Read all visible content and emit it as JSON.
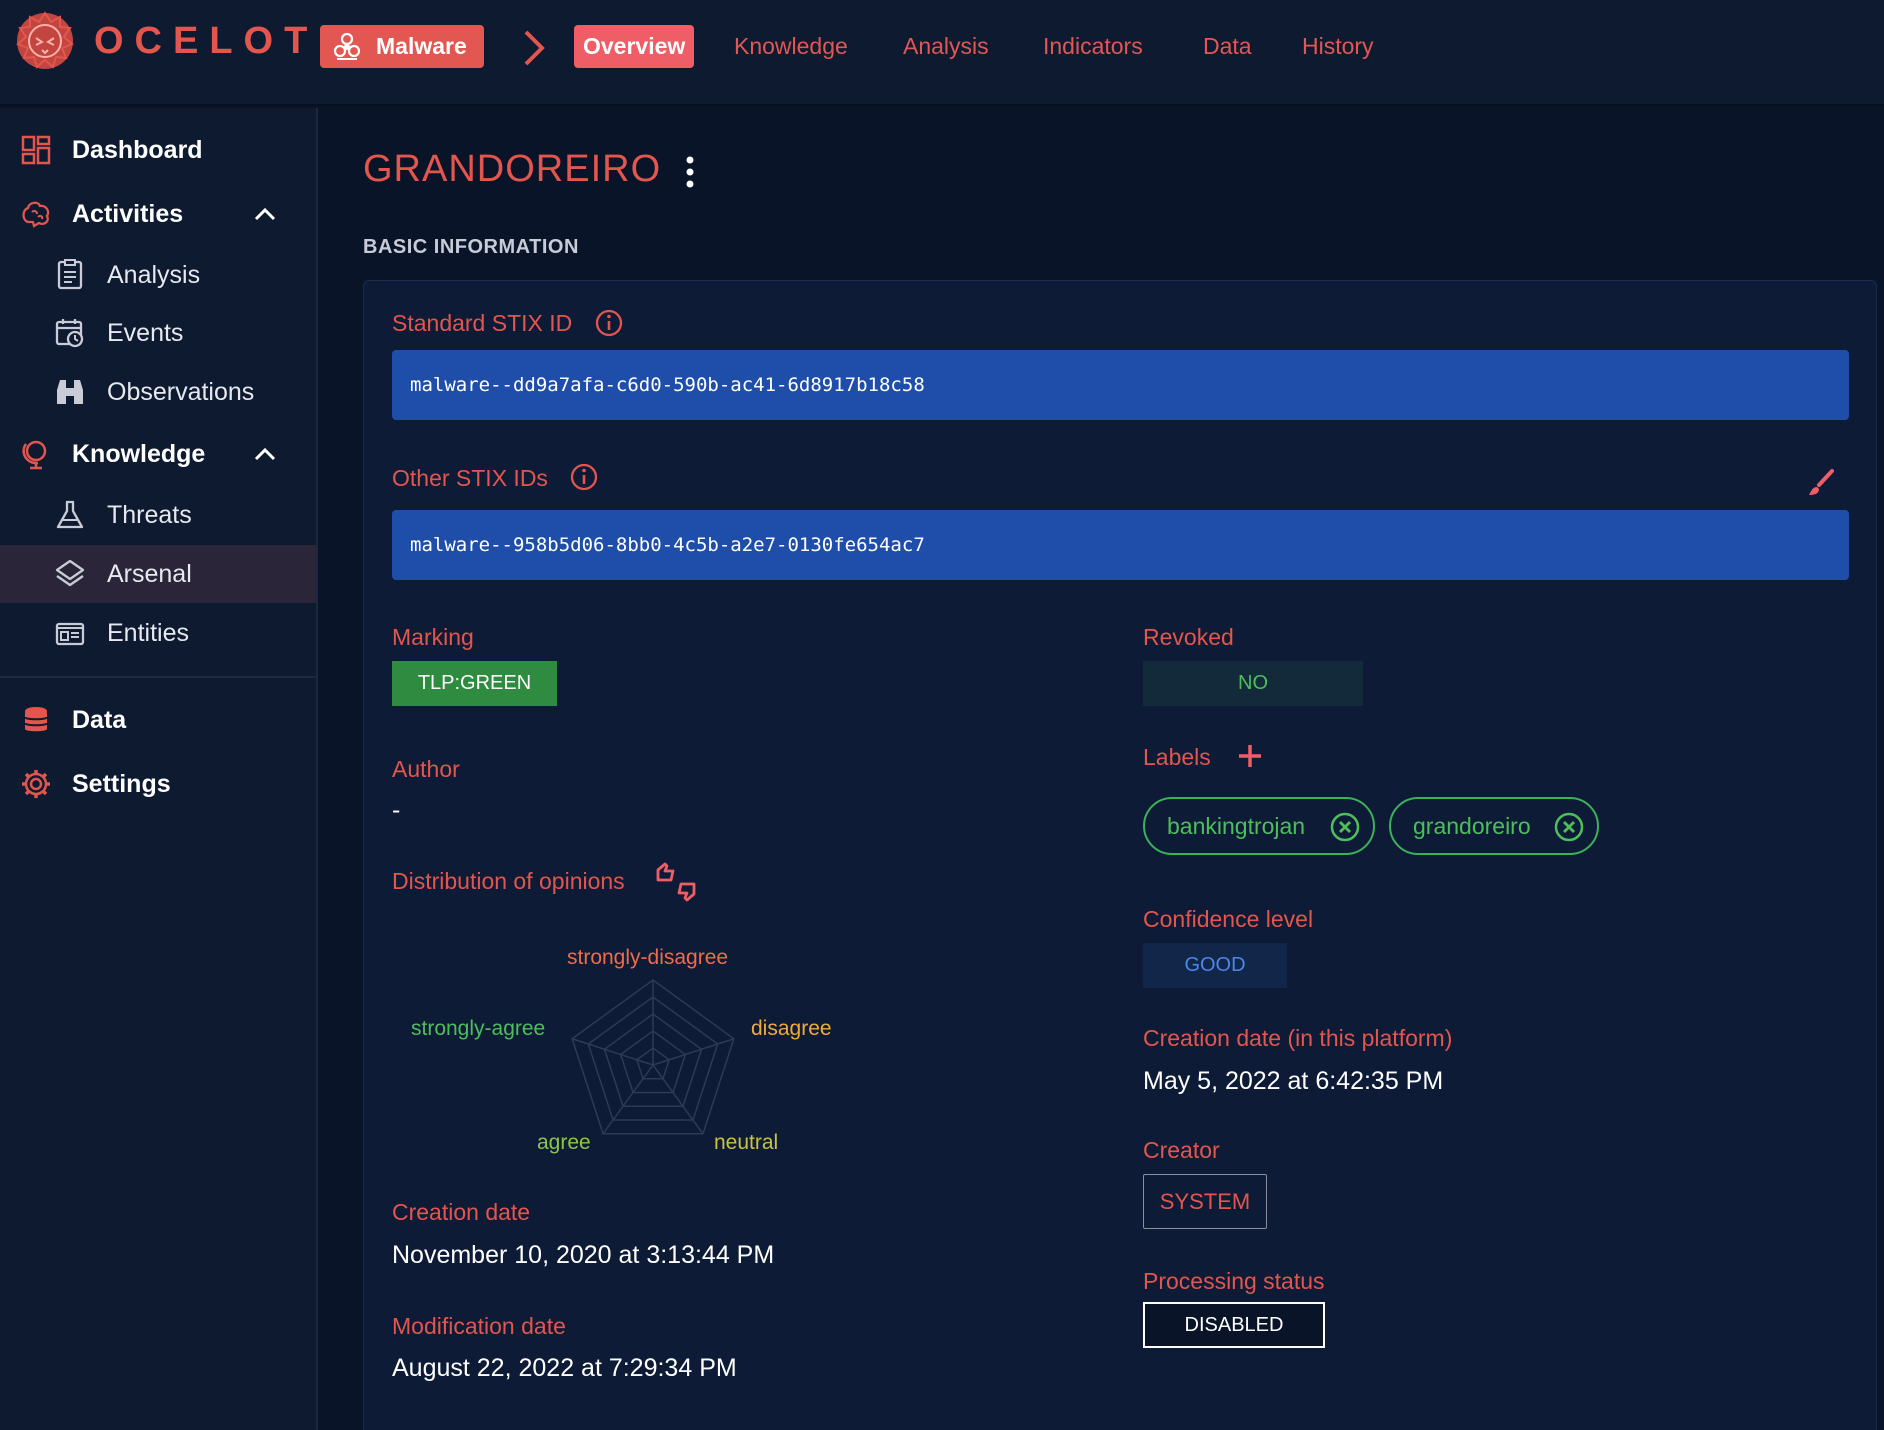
{
  "app": {
    "brand": "OCELOT"
  },
  "topbar": {
    "entity_type": "Malware",
    "tabs": [
      {
        "label": "Overview",
        "active": true
      },
      {
        "label": "Knowledge"
      },
      {
        "label": "Analysis"
      },
      {
        "label": "Indicators"
      },
      {
        "label": "Data"
      },
      {
        "label": "History"
      }
    ]
  },
  "sidebar": {
    "dashboard": "Dashboard",
    "activities": "Activities",
    "analysis": "Analysis",
    "events": "Events",
    "observations": "Observations",
    "knowledge": "Knowledge",
    "threats": "Threats",
    "arsenal": "Arsenal",
    "entities": "Entities",
    "data": "Data",
    "settings": "Settings",
    "selected": "Arsenal"
  },
  "page": {
    "title": "GRANDOREIRO",
    "section": "BASIC INFORMATION"
  },
  "fields": {
    "standard_stix_id_label": "Standard STIX ID",
    "standard_stix_id": "malware--dd9a7afa-c6d0-590b-ac41-6d8917b18c58",
    "other_stix_ids_label": "Other STIX IDs",
    "other_stix_ids": "malware--958b5d06-8bb0-4c5b-a2e7-0130fe654ac7",
    "marking_label": "Marking",
    "marking": "TLP:GREEN",
    "revoked_label": "Revoked",
    "revoked": "NO",
    "author_label": "Author",
    "author": "-",
    "labels_label": "Labels",
    "labels": [
      "bankingtrojan",
      "grandoreiro"
    ],
    "distribution_label": "Distribution of opinions",
    "confidence_label": "Confidence level",
    "confidence": "GOOD",
    "creation_platform_label": "Creation date (in this platform)",
    "creation_platform": "May 5, 2022 at 6:42:35 PM",
    "creator_label": "Creator",
    "creator": "SYSTEM",
    "creation_date_label": "Creation date",
    "creation_date": "November 10, 2020 at 3:13:44 PM",
    "processing_status_label": "Processing status",
    "processing_status": "DISABLED",
    "modification_date_label": "Modification date",
    "modification_date": "August 22, 2022 at 7:29:34 PM"
  },
  "opinions": {
    "axes": [
      "strongly-disagree",
      "disagree",
      "neutral",
      "agree",
      "strongly-agree"
    ],
    "colors": {
      "strongly-disagree": "#ef6b4a",
      "disagree": "#f2a93b",
      "neutral": "#c9c046",
      "agree": "#8fc34a",
      "strongly-agree": "#4cbf5b"
    }
  },
  "colors": {
    "accent": "#e2564d",
    "id_box": "#1e4ea9",
    "tlp_green": "#2e8b3f",
    "label_green": "#4cbf5b"
  }
}
